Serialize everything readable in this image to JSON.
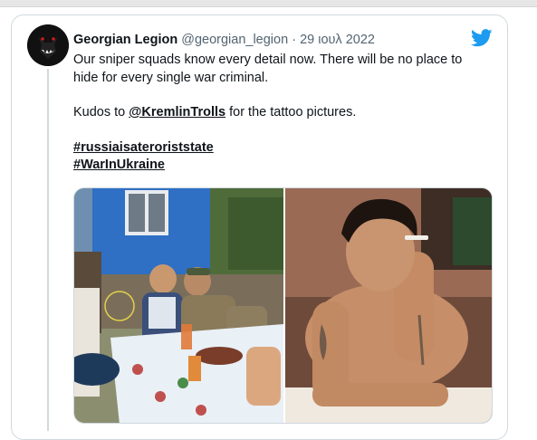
{
  "tweet": {
    "display_name": "Georgian Legion",
    "handle": "@georgian_legion",
    "separator": "·",
    "date": "29 ιουλ 2022",
    "line1": "Our sniper squads know every detail now. There will be no place to hide for every single war criminal.",
    "kudos_prefix": "Kudos to ",
    "mention": "@KremlinTrolls",
    "kudos_suffix": " for the tattoo pictures.",
    "hashtags": [
      "#russiaisateroriststate",
      "#WarInUkraine"
    ]
  },
  "icons": {
    "avatar": "wolf-logo-avatar",
    "brand": "twitter-bird-icon"
  },
  "colors": {
    "brand": "#1d9bf0",
    "text": "#0f1419",
    "secondary": "#536471",
    "border": "#cfd9de"
  }
}
